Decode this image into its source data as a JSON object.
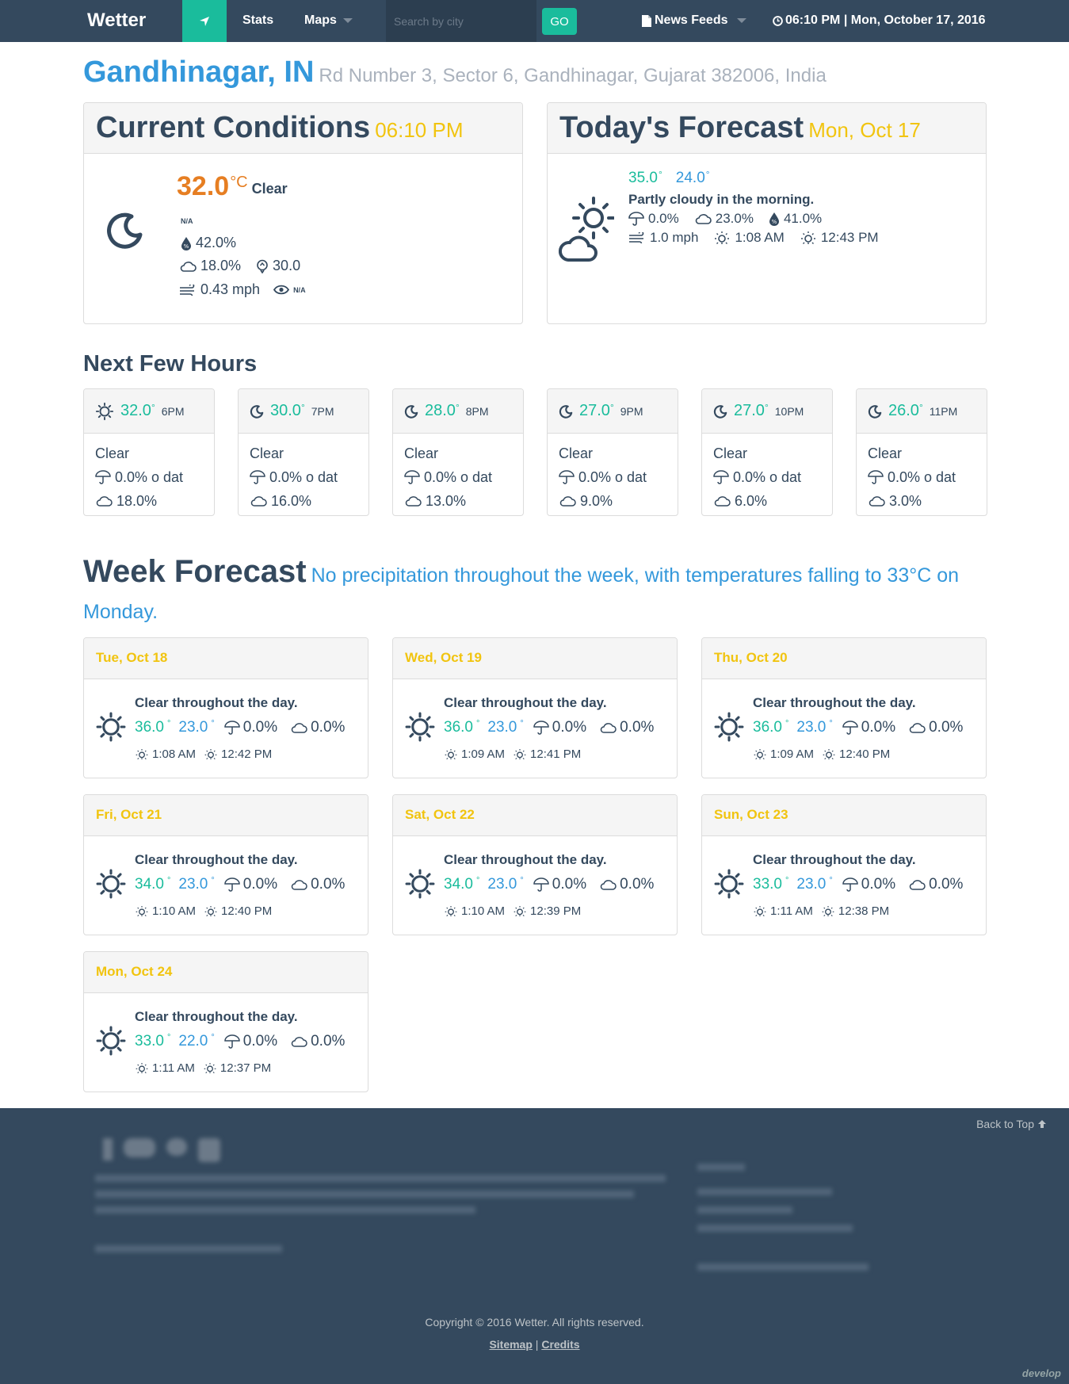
{
  "nav": {
    "brand": "Wetter",
    "stats": "Stats",
    "maps": "Maps",
    "search_placeholder": "Search by city",
    "go": "GO",
    "news": "News Feeds",
    "clock": "06:10 PM | Mon, October 17, 2016"
  },
  "location": {
    "city": "Gandhinagar, IN",
    "address": "Rd Number 3, Sector 6, Gandhinagar, Gujarat 382006, India"
  },
  "current": {
    "title": "Current Conditions",
    "time": "06:10 PM",
    "temp": "32.0",
    "unit": "°C",
    "condition": "Clear",
    "na1": "N/A",
    "humidity": "42.0%",
    "cloud": "18.0%",
    "dew": "30.0",
    "wind": "0.43 mph",
    "visibility": "N/A"
  },
  "today": {
    "title": "Today's Forecast",
    "date": "Mon, Oct 17",
    "high": "35.0",
    "low": "24.0",
    "summary": "Partly cloudy in the morning.",
    "precip": "0.0%",
    "cloud": "23.0%",
    "humidity": "41.0%",
    "wind": "1.0 mph",
    "sunrise": "1:08 AM",
    "sunset": "12:43 PM"
  },
  "hours": {
    "title": "Next Few Hours",
    "items": [
      {
        "temp": "32.0",
        "time": "6PM",
        "cond": "Clear",
        "precip": "0.0% o dat",
        "cloud": "18.0%",
        "icon": "sun-icon"
      },
      {
        "temp": "30.0",
        "time": "7PM",
        "cond": "Clear",
        "precip": "0.0% o dat",
        "cloud": "16.0%",
        "icon": "moon-icon"
      },
      {
        "temp": "28.0",
        "time": "8PM",
        "cond": "Clear",
        "precip": "0.0% o dat",
        "cloud": "13.0%",
        "icon": "moon-icon"
      },
      {
        "temp": "27.0",
        "time": "9PM",
        "cond": "Clear",
        "precip": "0.0% o dat",
        "cloud": "9.0%",
        "icon": "moon-icon"
      },
      {
        "temp": "27.0",
        "time": "10PM",
        "cond": "Clear",
        "precip": "0.0% o dat",
        "cloud": "6.0%",
        "icon": "moon-icon"
      },
      {
        "temp": "26.0",
        "time": "11PM",
        "cond": "Clear",
        "precip": "0.0% o dat",
        "cloud": "3.0%",
        "icon": "moon-icon"
      }
    ]
  },
  "week": {
    "title": "Week Forecast",
    "summary": "No precipitation throughout the week, with temperatures falling to 33°C on Monday.",
    "days": [
      {
        "date": "Tue, Oct 18",
        "summary": "Clear throughout the day.",
        "high": "36.0",
        "low": "23.0",
        "precip": "0.0%",
        "cloud": "0.0%",
        "sunrise": "1:08 AM",
        "sunset": "12:42 PM"
      },
      {
        "date": "Wed, Oct 19",
        "summary": "Clear throughout the day.",
        "high": "36.0",
        "low": "23.0",
        "precip": "0.0%",
        "cloud": "0.0%",
        "sunrise": "1:09 AM",
        "sunset": "12:41 PM"
      },
      {
        "date": "Thu, Oct 20",
        "summary": "Clear throughout the day.",
        "high": "36.0",
        "low": "23.0",
        "precip": "0.0%",
        "cloud": "0.0%",
        "sunrise": "1:09 AM",
        "sunset": "12:40 PM"
      },
      {
        "date": "Fri, Oct 21",
        "summary": "Clear throughout the day.",
        "high": "34.0",
        "low": "23.0",
        "precip": "0.0%",
        "cloud": "0.0%",
        "sunrise": "1:10 AM",
        "sunset": "12:40 PM"
      },
      {
        "date": "Sat, Oct 22",
        "summary": "Clear throughout the day.",
        "high": "34.0",
        "low": "23.0",
        "precip": "0.0%",
        "cloud": "0.0%",
        "sunrise": "1:10 AM",
        "sunset": "12:39 PM"
      },
      {
        "date": "Sun, Oct 23",
        "summary": "Clear throughout the day.",
        "high": "33.0",
        "low": "23.0",
        "precip": "0.0%",
        "cloud": "0.0%",
        "sunrise": "1:11 AM",
        "sunset": "12:38 PM"
      },
      {
        "date": "Mon, Oct 24",
        "summary": "Clear throughout the day.",
        "high": "33.0",
        "low": "22.0",
        "precip": "0.0%",
        "cloud": "0.0%",
        "sunrise": "1:11 AM",
        "sunset": "12:37 PM"
      }
    ]
  },
  "footer": {
    "back_to_top": "Back to Top",
    "copyright": "Copyright © 2016 Wetter. All rights reserved.",
    "sitemap": "Sitemap",
    "separator": "|",
    "credits": "Credits",
    "develop": "develop"
  },
  "colors": {
    "navy": "#34495e",
    "teal": "#1abc9c",
    "blue": "#3498db",
    "amber": "#f1c40f",
    "orange": "#e67e22"
  }
}
